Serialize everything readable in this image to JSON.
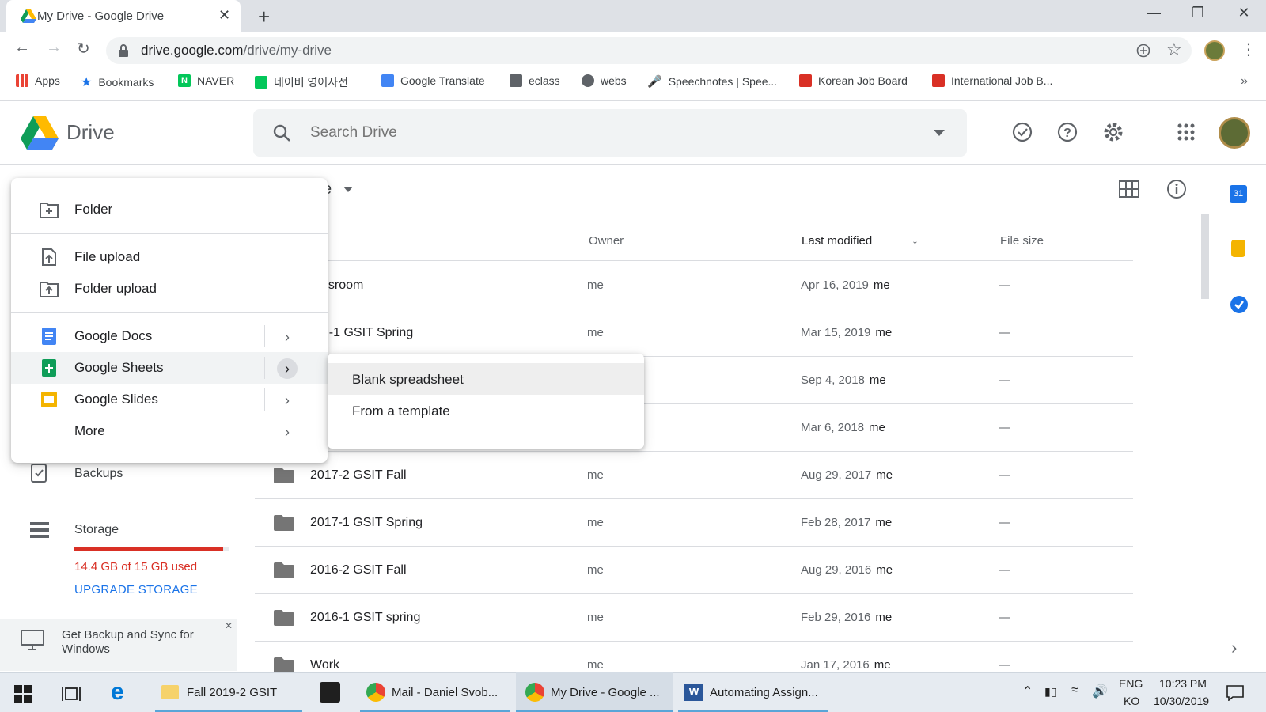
{
  "browser": {
    "tab_title": "My Drive - Google Drive",
    "tab_close": "✕",
    "new_tab": "+",
    "url_host": "drive.google.com",
    "url_path": "/drive/my-drive"
  },
  "bookmarks": [
    {
      "label": "Apps",
      "icon": "apps-grid-icon",
      "color": "#ea4335"
    },
    {
      "label": "Bookmarks",
      "icon": "star-icon",
      "color": "#1a73e8"
    },
    {
      "label": "NAVER",
      "icon": "naver-icon",
      "color": "#03c75a"
    },
    {
      "label": "네이버 영어사전",
      "icon": "naver-dictionary-icon",
      "color": "#03c75a"
    },
    {
      "label": "Google Translate",
      "icon": "translate-icon",
      "color": "#4285f4"
    },
    {
      "label": "eclass",
      "icon": "eclass-icon",
      "color": "#5f6368"
    },
    {
      "label": "webs",
      "icon": "globe-icon",
      "color": "#5f6368"
    },
    {
      "label": "Speechnotes | Spee...",
      "icon": "microphone-icon",
      "color": "#202124"
    },
    {
      "label": "Korean Job Board",
      "icon": "esl-cafe-icon",
      "color": "#d93025"
    },
    {
      "label": "International Job B...",
      "icon": "esl-cafe-icon",
      "color": "#d93025"
    }
  ],
  "drive": {
    "title": "Drive",
    "search_placeholder": "Search Drive"
  },
  "list": {
    "breadcrumb_fragment": "e",
    "columns": {
      "owner": "Owner",
      "modified": "Last modified",
      "size": "File size"
    },
    "rows": [
      {
        "name": "assroom",
        "owner": "me",
        "date": "Apr 16, 2019",
        "by": "me",
        "size": "—"
      },
      {
        "name": "19-1 GSIT Spring",
        "owner": "me",
        "date": "Mar 15, 2019",
        "by": "me",
        "size": "—"
      },
      {
        "name": "",
        "owner": "",
        "date": "Sep 4, 2018",
        "by": "me",
        "size": "—"
      },
      {
        "name": "",
        "owner": "",
        "date": "Mar 6, 2018",
        "by": "me",
        "size": "—"
      },
      {
        "name": "2017-2 GSIT Fall",
        "owner": "me",
        "date": "Aug 29, 2017",
        "by": "me",
        "size": "—"
      },
      {
        "name": "2017-1 GSIT Spring",
        "owner": "me",
        "date": "Feb 28, 2017",
        "by": "me",
        "size": "—"
      },
      {
        "name": "2016-2 GSIT Fall",
        "owner": "me",
        "date": "Aug 29, 2016",
        "by": "me",
        "size": "—"
      },
      {
        "name": "2016-1 GSIT spring",
        "owner": "me",
        "date": "Feb 29, 2016",
        "by": "me",
        "size": "—"
      },
      {
        "name": "Work",
        "owner": "me",
        "date": "Jan 17, 2016",
        "by": "me",
        "size": "—"
      }
    ]
  },
  "sidebar": {
    "backups": "Backups",
    "storage": "Storage",
    "storage_used": "14.4 GB of 15 GB used",
    "storage_fraction": 0.96,
    "upgrade": "UPGRADE STORAGE",
    "promo": "Get Backup and Sync for Windows",
    "promo_close": "✕"
  },
  "new_menu": {
    "folder": "Folder",
    "file_upload": "File upload",
    "folder_upload": "Folder upload",
    "docs": "Google Docs",
    "sheets": "Google Sheets",
    "slides": "Google Slides",
    "more": "More",
    "chevron": "›"
  },
  "sheets_submenu": {
    "blank": "Blank spreadsheet",
    "template": "From a template"
  },
  "taskbar": {
    "items": [
      "Fall 2019-2 GSIT",
      "Mail - Daniel Svob...",
      "My Drive - Google ...",
      "Automating Assign..."
    ],
    "lang_top": "ENG",
    "lang_bottom": "KO",
    "time": "10:23 PM",
    "date": "10/30/2019"
  },
  "colors": {
    "accent": "#1a73e8",
    "storage_bar": "#d93025",
    "sheets_green": "#0f9d58",
    "docs_blue": "#4285f4",
    "slides_yellow": "#f4b400"
  }
}
